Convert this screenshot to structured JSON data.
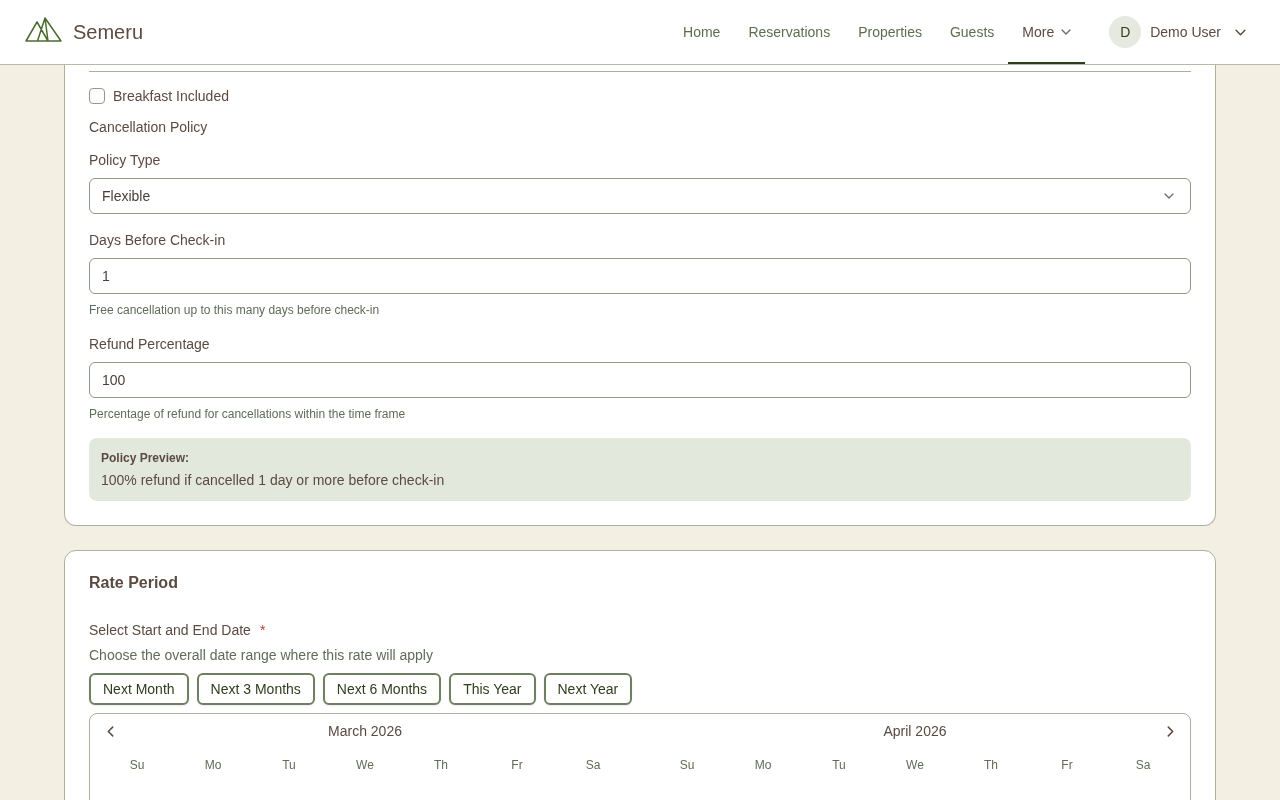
{
  "header": {
    "brand": "Semeru",
    "nav": [
      {
        "label": "Home",
        "selected": false,
        "menu": false
      },
      {
        "label": "Reservations",
        "selected": false,
        "menu": false
      },
      {
        "label": "Properties",
        "selected": false,
        "menu": false
      },
      {
        "label": "Guests",
        "selected": false,
        "menu": false
      },
      {
        "label": "More",
        "selected": true,
        "menu": true
      }
    ],
    "user": {
      "initial": "D",
      "name": "Demo User"
    }
  },
  "policy_card": {
    "breakfast": {
      "label": "Breakfast Included",
      "checked": false
    },
    "section_title": "Cancellation Policy",
    "fields": [
      {
        "kind": "select",
        "label": "Policy Type",
        "value": "Flexible"
      },
      {
        "kind": "input",
        "label": "Days Before Check-in",
        "value": "1",
        "help": "Free cancellation up to this many days before check-in"
      },
      {
        "kind": "input",
        "label": "Refund Percentage",
        "value": "100",
        "help": "Percentage of refund for cancellations within the time frame"
      }
    ],
    "preview": {
      "title": "Policy Preview:",
      "text": "100% refund if cancelled 1 day or more before check-in"
    }
  },
  "rate_period": {
    "title": "Rate Period",
    "date_label": "Select Start and End Date",
    "required_mark": "*",
    "help": "Choose the overall date range where this rate will apply",
    "presets": [
      "Next Month",
      "Next 3 Months",
      "Next 6 Months",
      "This Year",
      "Next Year"
    ],
    "calendar": {
      "months": [
        {
          "title": "March 2026",
          "weekdays": [
            "Su",
            "Mo",
            "Tu",
            "We",
            "Th",
            "Fr",
            "Sa"
          ]
        },
        {
          "title": "April 2026",
          "weekdays": [
            "Su",
            "Mo",
            "Tu",
            "We",
            "Th",
            "Fr",
            "Sa"
          ]
        }
      ]
    }
  }
}
